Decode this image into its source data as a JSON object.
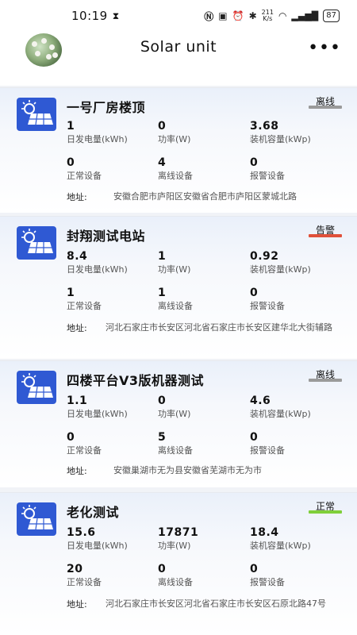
{
  "status_bar": {
    "time": "10:19",
    "speed_value": "211",
    "speed_unit": "K/s",
    "battery": "87"
  },
  "header": {
    "title": "Solar unit",
    "more": "•••"
  },
  "labels": {
    "daily_gen": "日发电量(kWh)",
    "power": "功率(W)",
    "capacity": "装机容量(kWp)",
    "normal": "正常设备",
    "offline": "离线设备",
    "alarm": "报警设备",
    "address": "地址:"
  },
  "colors": {
    "offline": "#9a9a9a",
    "alarm": "#e0513a",
    "normal": "#7fcf3a",
    "logo": "#2f59d3"
  },
  "stations": [
    {
      "name": "一号厂房楼顶",
      "status": "离线",
      "daily_gen": "1",
      "power": "0",
      "capacity": "3.68",
      "normal": "0",
      "offline": "4",
      "alarm": "0",
      "address": "安徽合肥市庐阳区安徽省合肥市庐阳区蒙城北路"
    },
    {
      "name": "封翔测试电站",
      "status": "告警",
      "daily_gen": "8.4",
      "power": "1",
      "capacity": "0.92",
      "normal": "1",
      "offline": "1",
      "alarm": "0",
      "address": "河北石家庄市长安区河北省石家庄市长安区建华北大街辅路"
    },
    {
      "name": "四楼平台V3版机器测试",
      "status": "离线",
      "daily_gen": "1.1",
      "power": "0",
      "capacity": "4.6",
      "normal": "0",
      "offline": "5",
      "alarm": "0",
      "address": "安徽巢湖市无为县安徽省芜湖市无为市"
    },
    {
      "name": "老化测试",
      "status": "正常",
      "daily_gen": "15.6",
      "power": "17871",
      "capacity": "18.4",
      "normal": "20",
      "offline": "0",
      "alarm": "0",
      "address": "河北石家庄市长安区河北省石家庄市长安区石原北路47号"
    }
  ]
}
